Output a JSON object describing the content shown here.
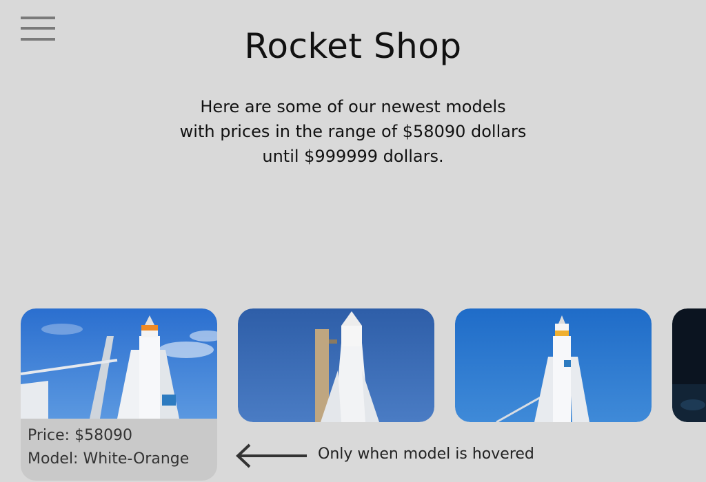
{
  "header": {
    "title": "Rocket Shop",
    "intro_line1": "Here are some of our newest models",
    "intro_line2": "with prices in the range of $58090 dollars",
    "intro_line3": "until $999999 dollars."
  },
  "products": [
    {
      "price": "Price: $58090",
      "model": "Model: White-Orange",
      "hovered": true
    },
    {
      "hovered": false
    },
    {
      "hovered": false
    },
    {
      "hovered": false
    }
  ],
  "hint": {
    "text": "Only when model is hovered"
  },
  "icons": {
    "menu": "hamburger-menu-icon",
    "arrow": "arrow-left-icon"
  },
  "colors": {
    "background": "#d9d9d9",
    "card_hover_bg": "#c9c9c9",
    "sky_blue": "#2f74c9"
  }
}
